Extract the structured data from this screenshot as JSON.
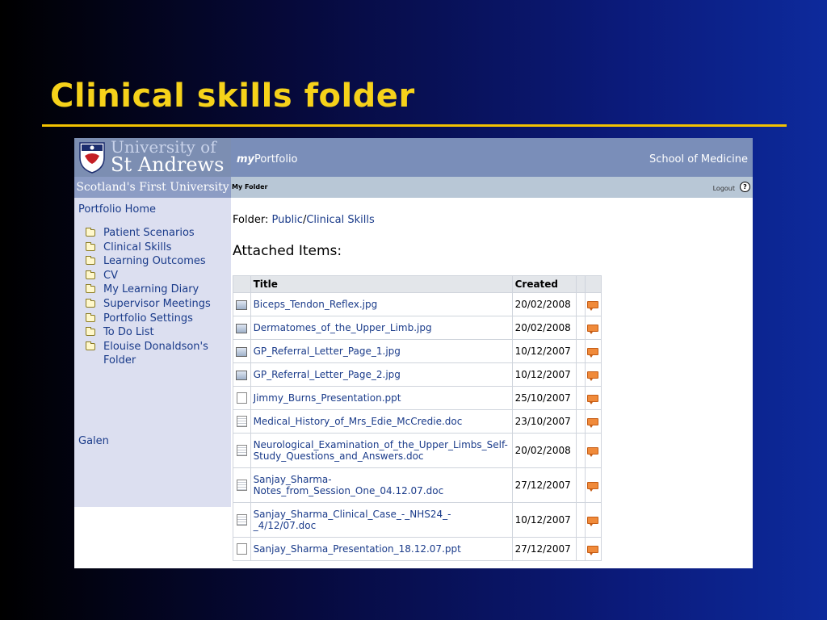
{
  "slide": {
    "title": "Clinical skills folder"
  },
  "header": {
    "university_line1": "University of",
    "university_line2": "St Andrews",
    "tagline": "Scotland's First University",
    "brand_prefix": "my",
    "brand_suffix": "Portfolio",
    "school": "School of Medicine"
  },
  "subheader": {
    "location": "My Folder",
    "logout": "Logout",
    "help": "?"
  },
  "sidebar": {
    "home": "Portfolio Home",
    "folders": [
      "Patient Scenarios",
      "Clinical Skills",
      "Learning Outcomes",
      "CV",
      "My Learning Diary",
      "Supervisor Meetings",
      "Portfolio Settings",
      "To Do List",
      "Elouise Donaldson's Folder"
    ],
    "galen": "Galen"
  },
  "main": {
    "folder_label": "Folder:",
    "path_public": "Public",
    "path_separator": "/",
    "path_folder": "Clinical Skills",
    "attached_heading": "Attached Items:",
    "columns": {
      "title": "Title",
      "created": "Created"
    },
    "items": [
      {
        "title": "Biceps_Tendon_Reflex.jpg",
        "created": "20/02/2008",
        "icon": "image-file-icon"
      },
      {
        "title": "Dermatomes_of_the_Upper_Limb.jpg",
        "created": "20/02/2008",
        "icon": "image-file-icon"
      },
      {
        "title": "GP_Referral_Letter_Page_1.jpg",
        "created": "10/12/2007",
        "icon": "image-file-icon"
      },
      {
        "title": "GP_Referral_Letter_Page_2.jpg",
        "created": "10/12/2007",
        "icon": "image-file-icon"
      },
      {
        "title": "Jimmy_Burns_Presentation.ppt",
        "created": "25/10/2007",
        "icon": "presentation-file-icon"
      },
      {
        "title": "Medical_History_of_Mrs_Edie_McCredie.doc",
        "created": "23/10/2007",
        "icon": "document-file-icon"
      },
      {
        "title": "Neurological_Examination_of_the_Upper_Limbs_Self-Study_Questions_and_Answers.doc",
        "created": "20/02/2008",
        "icon": "document-file-icon"
      },
      {
        "title": "Sanjay_Sharma-Notes_from_Session_One_04.12.07.doc",
        "created": "27/12/2007",
        "icon": "document-file-icon"
      },
      {
        "title": "Sanjay_Sharma_Clinical_Case_-_NHS24_-_4/12/07.doc",
        "created": "10/12/2007",
        "icon": "document-file-icon"
      },
      {
        "title": "Sanjay_Sharma_Presentation_18.12.07.ppt",
        "created": "27/12/2007",
        "icon": "presentation-file-icon"
      }
    ]
  },
  "colors": {
    "slide_title": "#f6d21a",
    "rule": "#f2c200",
    "header_bar": "#7a8eb9",
    "sidebar_bg": "#dcdff0",
    "link": "#1a3b8a",
    "comment_icon": "#f08a3a"
  }
}
